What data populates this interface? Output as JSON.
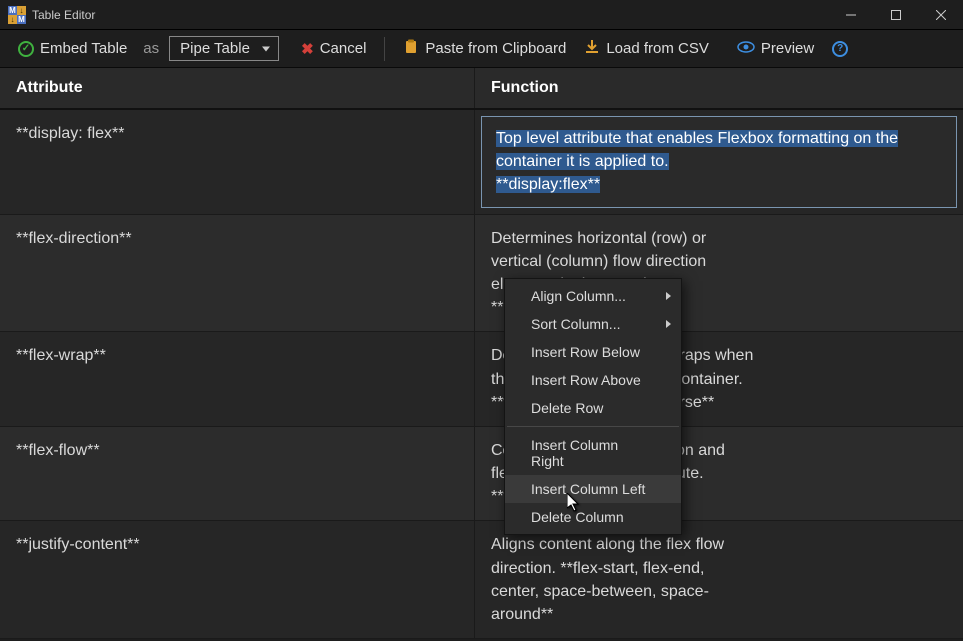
{
  "window": {
    "title": "Table Editor"
  },
  "toolbar": {
    "embed": "Embed Table",
    "as": "as",
    "mode": "Pipe Table",
    "cancel": "Cancel",
    "paste": "Paste from Clipboard",
    "csv": "Load from CSV",
    "preview": "Preview"
  },
  "columns": {
    "c0": "Attribute",
    "c1": "Function"
  },
  "rows": [
    {
      "attr": "**display: flex**",
      "func_sel": "Top level attribute that enables Flexbox formatting on the container it is applied to.",
      "func_tail": "**display:flex**"
    },
    {
      "attr": "**flex-direction**",
      "func": "Determines horizontal (row) or vertical (column) flow direction elements in the container. **row,column**"
    },
    {
      "attr": "**flex-wrap**",
      "func": "Determines how content wraps when the content overflows the container. **wrap, nowrap, wrap-reverse**"
    },
    {
      "attr": "**flex-flow**",
      "func": "Combination of flex-direction and flex-wrap as a single attribute. **flex-flow: row nowrap**"
    },
    {
      "attr": "**justify-content**",
      "func": "Aligns content along the flex flow direction. **flex-start, flex-end, center, space-between, space-around**"
    }
  ],
  "context_menu": {
    "align": "Align Column...",
    "sort": "Sort Column...",
    "ins_row_below": "Insert Row Below",
    "ins_row_above": "Insert Row Above",
    "del_row": "Delete Row",
    "ins_col_right": "Insert Column Right",
    "ins_col_left": "Insert Column Left",
    "del_col": "Delete Column"
  }
}
